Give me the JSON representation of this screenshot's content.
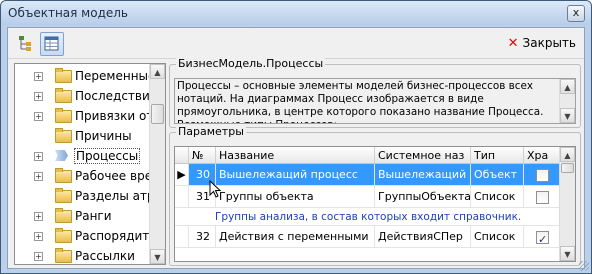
{
  "window": {
    "title": "Объектная модель",
    "close_glyph": "x"
  },
  "toolbar": {
    "buttons": [
      {
        "icon": "tree-structure-icon"
      },
      {
        "icon": "table-grid-icon",
        "active": true
      }
    ],
    "close_label": "Закрыть",
    "close_icon": "red-x-icon"
  },
  "tree": {
    "items": [
      {
        "label": "Переменные",
        "icon": "folder-icon",
        "expandable": true
      },
      {
        "label": "Последствия",
        "icon": "folder-icon",
        "expandable": true
      },
      {
        "label": "Привязки от",
        "icon": "folder-icon",
        "expandable": true
      },
      {
        "label": "Причины",
        "icon": "folder-icon",
        "expandable": false
      },
      {
        "label": "Процессы",
        "icon": "process-arrow-icon",
        "expandable": true,
        "selected": true
      },
      {
        "label": "Рабочее вре",
        "icon": "folder-icon",
        "expandable": true
      },
      {
        "label": "Разделы атр",
        "icon": "folder-icon",
        "expandable": false
      },
      {
        "label": "Ранги",
        "icon": "folder-icon",
        "expandable": true
      },
      {
        "label": "Распорядите",
        "icon": "folder-icon",
        "expandable": true
      },
      {
        "label": "Рассылки",
        "icon": "folder-icon",
        "expandable": true
      }
    ]
  },
  "description": {
    "legend": "БизнесМодель.Процессы",
    "text": "Процессы – основные элементы моделей бизнес-процессов всех нотаций. На диаграммах Процесс изображается в виде прямоугольника, в центре которого показано название Процесса. Возможные типы Процессов:"
  },
  "params": {
    "legend": "Параметры",
    "columns": [
      "№",
      "Название",
      "Системное наз",
      "Тип",
      "Хра"
    ],
    "rows": [
      {
        "num": "30",
        "name": "Вышележащий процесс",
        "sysname": "Вышележащий",
        "type": "Объект",
        "stored": false,
        "selected": true
      },
      {
        "num": "31",
        "name": "Группы объекта",
        "sysname": "ГруппыОбъекта",
        "type": "Список",
        "stored": false,
        "detail": "Группы анализа, в состав которых входит справочник."
      },
      {
        "num": "32",
        "name": "Действия с переменными",
        "sysname": "ДействияСПер",
        "type": "Список",
        "stored": true
      }
    ]
  }
}
